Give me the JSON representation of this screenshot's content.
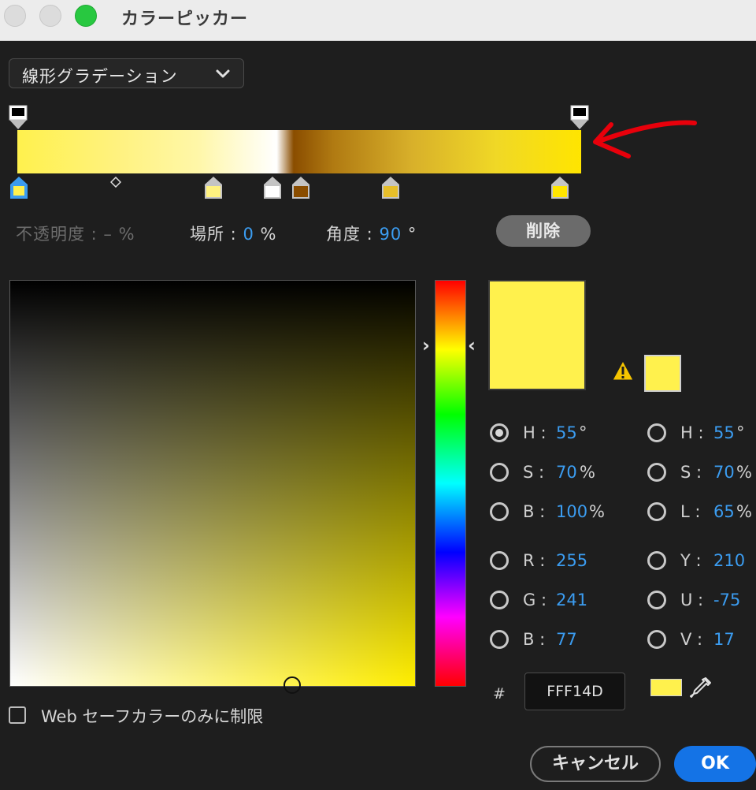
{
  "window": {
    "title": "カラーピッカー",
    "buttons": [
      "close",
      "minimize",
      "zoom"
    ]
  },
  "gradient_type": {
    "selected": "線形グラデーション"
  },
  "gradient": {
    "color_stops": [
      "#FFF14D",
      "#FFF280",
      "#FFFFFF",
      "#8A4D00",
      "#E6BE2A",
      "#FFE500"
    ],
    "opacity_stops": [
      "#000000",
      "#000000"
    ]
  },
  "stop_info": {
    "opacity_label": "不透明度 : – %",
    "location_label": "場所 :",
    "location_value": "0",
    "location_unit": "%",
    "angle_label": "角度 :",
    "angle_value": "90",
    "angle_unit": "°",
    "delete_label": "削除"
  },
  "color_values": {
    "hsb": {
      "h": {
        "label": "H :",
        "value": "55",
        "unit": "°"
      },
      "s": {
        "label": "S :",
        "value": "70",
        "unit": "%"
      },
      "b": {
        "label": "B :",
        "value": "100",
        "unit": "%"
      }
    },
    "hsl": {
      "h": {
        "label": "H :",
        "value": "55",
        "unit": "°"
      },
      "s": {
        "label": "S :",
        "value": "70",
        "unit": "%"
      },
      "l": {
        "label": "L :",
        "value": "65",
        "unit": "%"
      }
    },
    "rgb": {
      "r": {
        "label": "R :",
        "value": "255"
      },
      "g": {
        "label": "G :",
        "value": "241"
      },
      "b": {
        "label": "B :",
        "value": "77"
      }
    },
    "yuv": {
      "y": {
        "label": "Y :",
        "value": "210"
      },
      "u": {
        "label": "U :",
        "value": "-75"
      },
      "v": {
        "label": "V :",
        "value": "17"
      }
    },
    "selected_mode": "H"
  },
  "hex": {
    "hash": "#",
    "value": "FFF14D"
  },
  "current_color": "#FFF14D",
  "web_safe": {
    "label": "Web セーフカラーのみに制限",
    "checked": false
  },
  "buttons": {
    "cancel": "キャンセル",
    "ok": "OK"
  },
  "icons": [
    "chevron-down-icon",
    "warning-icon",
    "eyedropper-icon",
    "annotation-arrow"
  ],
  "colors": {
    "accent": "#1473E6",
    "value_blue": "#3B9CF0",
    "annotation_red": "#E8000B"
  }
}
